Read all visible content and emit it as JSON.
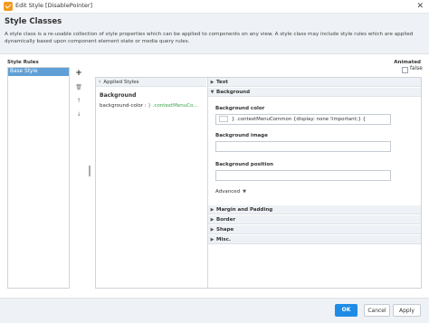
{
  "window": {
    "title": "Edit Style [DisablePointer]",
    "close_glyph": "✕",
    "icon": "ignition-check-icon"
  },
  "header": {
    "title": "Style Classes",
    "description": "A style class is a re-usable collection of style properties which can be applied to components on any view. A style class may include style rules which are applied dynamically based upon component element state or media query rules."
  },
  "rules": {
    "label": "Style Rules",
    "items": [
      {
        "label": "Base Style",
        "selected": true
      }
    ],
    "add_glyph": "+",
    "delete_glyph": "🗑",
    "up_glyph": "↑",
    "down_glyph": "↓"
  },
  "animated": {
    "label": "Animated",
    "value": "false",
    "checked": false
  },
  "applied": {
    "header": "Applied Styles",
    "back_glyph": "‹",
    "section": "Background",
    "property_name": "background-color",
    "property_separator": " : ",
    "property_value": "} .contextMenuCo..."
  },
  "sections": {
    "text": "Text",
    "background": "Background",
    "margin_padding": "Margin and Padding",
    "border": "Border",
    "shape": "Shape",
    "misc": "Misc."
  },
  "background": {
    "color_label": "Background color",
    "color_value": "} .contextMenuCommon {display: none !important;}  {",
    "image_label": "Background image",
    "image_value": "",
    "position_label": "Background position",
    "position_value": "",
    "advanced_label": "Advanced"
  },
  "buttons": {
    "ok": "OK",
    "cancel": "Cancel",
    "apply": "Apply"
  },
  "colors": {
    "accent": "#1e8ce6",
    "selection": "#5f9fd6",
    "value_green": "#3aa349",
    "panel_bg": "#eef1f5"
  }
}
